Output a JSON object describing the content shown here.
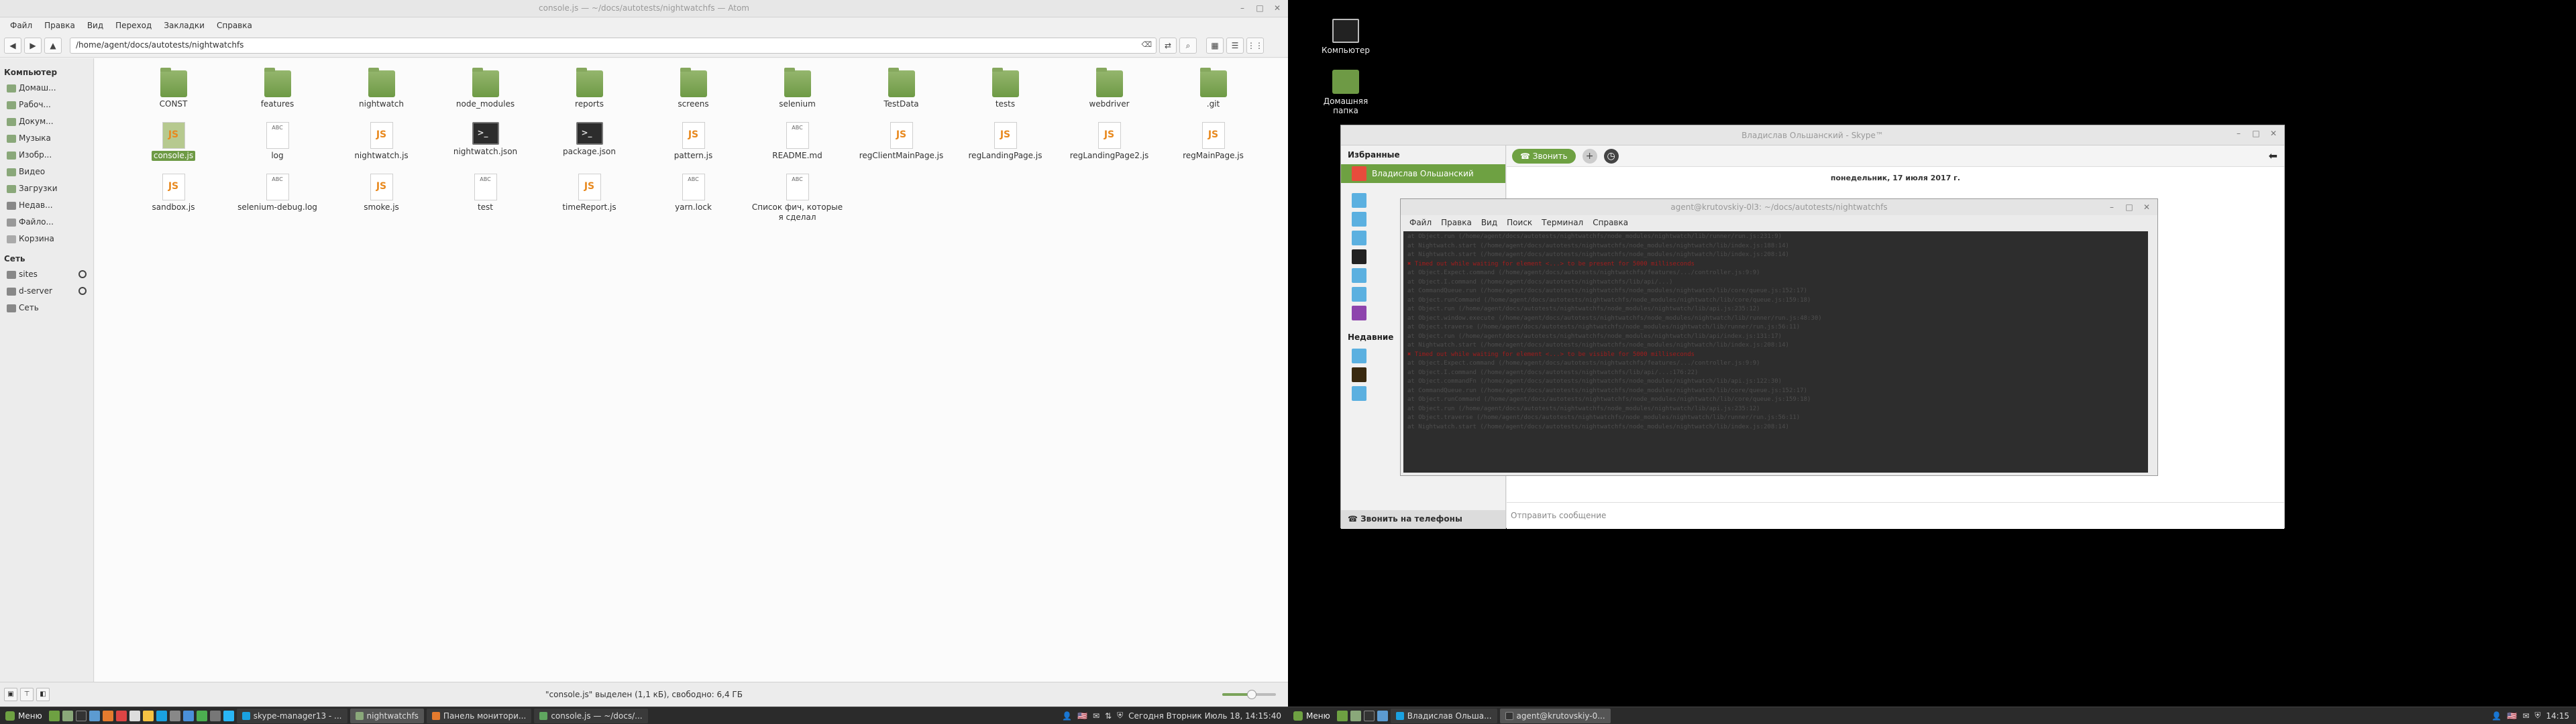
{
  "left_monitor": {
    "window_title": "console.js — ~/docs/autotests/nightwatchfs — Atom",
    "menu": [
      "Файл",
      "Правка",
      "Вид",
      "Переход",
      "Закладки",
      "Справка"
    ],
    "location": "/home/agent/docs/autotests/nightwatchfs",
    "sidebar": {
      "computer_header": "Компьютер",
      "computer_items": [
        "Домаш...",
        "Рабоч...",
        "Докум...",
        "Музыка",
        "Изобр...",
        "Видео",
        "Загрузки",
        "Недав...",
        "Файло...",
        "Корзина"
      ],
      "network_header": "Сеть",
      "network_items": [
        "sites",
        "d-server",
        "Сеть"
      ]
    },
    "files": [
      {
        "name": "CONST",
        "type": "folder"
      },
      {
        "name": "features",
        "type": "folder"
      },
      {
        "name": "nightwatch",
        "type": "folder"
      },
      {
        "name": "node_modules",
        "type": "folder"
      },
      {
        "name": "reports",
        "type": "folder"
      },
      {
        "name": "screens",
        "type": "folder"
      },
      {
        "name": "selenium",
        "type": "folder"
      },
      {
        "name": "TestData",
        "type": "folder"
      },
      {
        "name": "tests",
        "type": "folder"
      },
      {
        "name": "webdriver",
        "type": "folder"
      },
      {
        "name": ".git",
        "type": "folder"
      },
      {
        "name": "console.js",
        "type": "js",
        "selected": true
      },
      {
        "name": "log",
        "type": "txt"
      },
      {
        "name": "nightwatch.js",
        "type": "js"
      },
      {
        "name": "nightwatch.json",
        "type": "term"
      },
      {
        "name": "package.json",
        "type": "term"
      },
      {
        "name": "pattern.js",
        "type": "js"
      },
      {
        "name": "README.md",
        "type": "txt"
      },
      {
        "name": "regClientMainPage.js",
        "type": "js"
      },
      {
        "name": "regLandingPage.js",
        "type": "js"
      },
      {
        "name": "regLandingPage2.js",
        "type": "js"
      },
      {
        "name": "regMainPage.js",
        "type": "js"
      },
      {
        "name": "sandbox.js",
        "type": "js"
      },
      {
        "name": "selenium-debug.log",
        "type": "txt"
      },
      {
        "name": "smoke.js",
        "type": "js"
      },
      {
        "name": "test",
        "type": "txt"
      },
      {
        "name": "timeReport.js",
        "type": "js"
      },
      {
        "name": "yarn.lock",
        "type": "txt"
      },
      {
        "name": "Список фич, которые я сделал",
        "type": "txt"
      }
    ],
    "status_text": "\"console.js\" выделен (1,1 кБ), свободно: 6,4 ГБ",
    "zoom_level": 0.55
  },
  "taskbar_left": {
    "menu_label": "Меню",
    "tasks": [
      {
        "label": "skype-manager13 - ...",
        "active": false
      },
      {
        "label": "nightwatchfs",
        "active": true
      },
      {
        "label": "Панель монитори...",
        "active": false
      },
      {
        "label": "console.js — ~/docs/...",
        "active": false
      }
    ],
    "tray_text": "Сегодня Вторник Июль 18, 14:15:40"
  },
  "taskbar_right": {
    "menu_label": "Меню",
    "tasks": [
      {
        "label": "Владислав Ольша...",
        "active": false
      },
      {
        "label": "agent@krutovskiy-0...",
        "active": true
      }
    ],
    "clock": "14:15"
  },
  "desktop_icons": [
    "Компьютер",
    "Домашняя папка"
  ],
  "skype": {
    "window_title": "Владислав Ольшанский - Skype™",
    "favorites_header": "Избранные",
    "active_contact": "Владислав Ольшанский",
    "recent_header": "Недавние",
    "call_phones": "Звонить на телефоны",
    "call_button": "Звонить",
    "date_line": "понедельник, 17 июля 2017 г.",
    "message_placeholder": "Отправить сообщение"
  },
  "terminal": {
    "window_title": "agent@krutovskiy-0l3: ~/docs/autotests/nightwatchfs",
    "menu": [
      "Файл",
      "Правка",
      "Вид",
      "Поиск",
      "Терминал",
      "Справка"
    ],
    "lines": [
      {
        "t": "    at Object.run (/home/agent/docs/autotests/nightwatchfs/node_modules/nightwatch/lib/runner/run.js:231:9)",
        "red": false
      },
      {
        "t": "    at Nightwatch.start (/home/agent/docs/autotests/nightwatchfs/node_modules/nightwatch/lib/index.js:188:14)",
        "red": false
      },
      {
        "t": "    at Nightwatch.start (/home/agent/docs/autotests/nightwatchfs/node_modules/nightwatch/lib/index.js:208:14)",
        "red": false
      },
      {
        "t": "✖ Timed out while waiting for element <...> to be present for 5000 milliseconds",
        "red": true
      },
      {
        "t": "    at Object.Expect.command (/home/agent/docs/autotests/nightwatchfs/features/.../controller.js:9:9)",
        "red": false
      },
      {
        "t": "    at Object.I.command (/home/agent/docs/autotests/nightwatchfs/lib/api/...)",
        "red": false
      },
      {
        "t": "    at CommandQueue.run (/home/agent/docs/autotests/nightwatchfs/node_modules/nightwatch/lib/core/queue.js:152:17)",
        "red": false
      },
      {
        "t": "    at Object.runCommand (/home/agent/docs/autotests/nightwatchfs/node_modules/nightwatch/lib/core/queue.js:159:18)",
        "red": false
      },
      {
        "t": "    at Object.run (/home/agent/docs/autotests/nightwatchfs/node_modules/nightwatch/lib/api.js:235:12)",
        "red": false
      },
      {
        "t": "    at Object.window.execute (/home/agent/docs/autotests/nightwatchfs/node_modules/nightwatch/lib/runner/run.js:48:30)",
        "red": false
      },
      {
        "t": "    at Object.traverse (/home/agent/docs/autotests/nightwatchfs/node_modules/nightwatch/lib/runner/run.js:56:11)",
        "red": false
      },
      {
        "t": "    at Object.run (/home/agent/docs/autotests/nightwatchfs/node_modules/nightwatch/lib/api/index.js:131:17)",
        "red": false
      },
      {
        "t": "    at Nightwatch.start (/home/agent/docs/autotests/nightwatchfs/node_modules/nightwatch/lib/index.js:208:14)",
        "red": false
      },
      {
        "t": "✖ Timed out while waiting for element <...> to be visible for 5000 milliseconds",
        "red": true
      },
      {
        "t": "    at Object.Expect.command (/home/agent/docs/autotests/nightwatchfs/features/.../controller.js:9:9)",
        "red": false
      },
      {
        "t": "    at Object.I.command (/home/agent/docs/autotests/nightwatchfs/lib/api/...:176:22)",
        "red": false
      },
      {
        "t": "    at Object.commandFn (/home/agent/docs/autotests/nightwatchfs/node_modules/nightwatch/lib/api.js:122:30)",
        "red": false
      },
      {
        "t": "    at CommandQueue.run (/home/agent/docs/autotests/nightwatchfs/node_modules/nightwatch/lib/core/queue.js:152:17)",
        "red": false
      },
      {
        "t": "    at Object.runCommand (/home/agent/docs/autotests/nightwatchfs/node_modules/nightwatch/lib/core/queue.js:159:18)",
        "red": false
      },
      {
        "t": "    at Object.run (/home/agent/docs/autotests/nightwatchfs/node_modules/nightwatch/lib/api.js:235:12)",
        "red": false
      },
      {
        "t": "    at Object.traverse (/home/agent/docs/autotests/nightwatchfs/node_modules/nightwatch/lib/runner/run.js:56:11)",
        "red": false
      },
      {
        "t": "    at Nightwatch.start (/home/agent/docs/autotests/nightwatchfs/node_modules/nightwatch/lib/index.js:208:14)",
        "red": false
      }
    ]
  },
  "colors": {
    "accent": "#6ea142",
    "taskbar": "#2b2b2b",
    "terminal_bg": "#2d2d2d",
    "terminal_error": "#a31d1d"
  }
}
